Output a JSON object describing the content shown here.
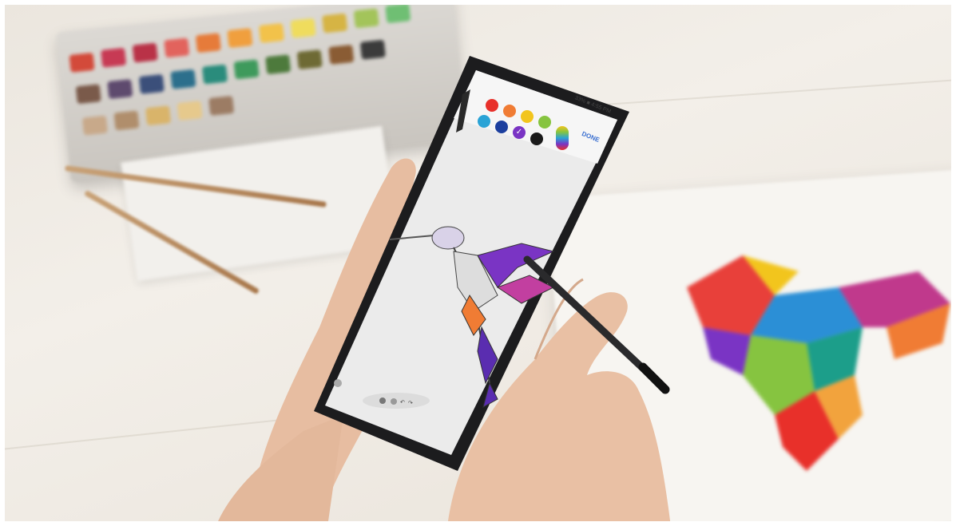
{
  "phone": {
    "status_bar": "33% ■ 4:55 PM",
    "done_label": "DONE",
    "pen_colors": [
      "#e8302a",
      "#f07c34",
      "#f2c51d",
      "#2aa3d6",
      "#1c3f9e",
      "#7a34c4",
      "#86c440",
      "#1a1a1a"
    ],
    "selected_color": "#7a34c4"
  },
  "colors": {
    "table": "#f3efe9",
    "skin": "#e9c2a8",
    "phone_body": "#1c1c1e",
    "screen": "#eeeeee",
    "stylus": "#2a2a2c"
  }
}
